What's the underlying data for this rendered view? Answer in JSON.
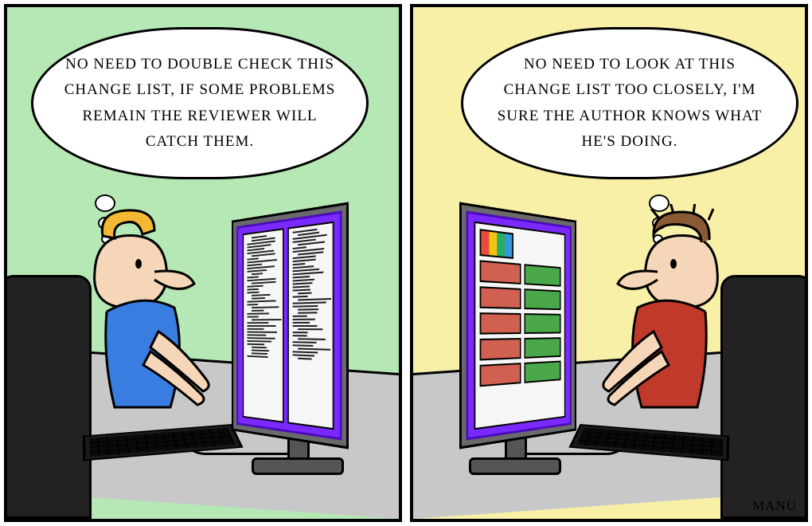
{
  "panels": {
    "left": {
      "role": "author",
      "thought": "No need to double check this change list, if some problems remain the reviewer will catch them.",
      "screen": "code-editor"
    },
    "right": {
      "role": "reviewer",
      "thought": "No need to look at this change list too closely, I'm sure the author knows what he's doing.",
      "screen": "code-diff"
    }
  },
  "signature": "MANU",
  "colors": {
    "left_bg": "#b5e8b5",
    "right_bg": "#f9f0a8",
    "monitor_bezel": "#7a2aff",
    "shirt_left": "#3a7de0",
    "shirt_right": "#c0392b",
    "diff_add": "#4aa84a",
    "diff_del": "#d06050"
  }
}
